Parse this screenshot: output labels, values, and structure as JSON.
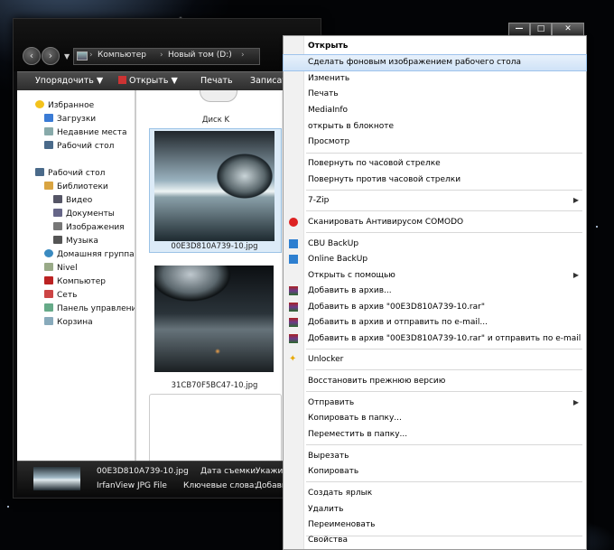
{
  "address": {
    "crumbs": [
      "Компьютер",
      "Новый том (D:)"
    ]
  },
  "toolbar": {
    "organize": "Упорядочить",
    "open": "Открыть",
    "print": "Печать",
    "record": "Записат"
  },
  "sidebar": {
    "items": [
      {
        "label": "Избранное",
        "icon": "star-icon"
      },
      {
        "label": "Загрузки",
        "icon": "downloads-folder-icon"
      },
      {
        "label": "Недавние места",
        "icon": "recent-places-icon"
      },
      {
        "label": "Рабочий стол",
        "icon": "desktop-icon"
      },
      {
        "label": "Рабочий стол",
        "icon": "desktop-icon"
      },
      {
        "label": "Библиотеки",
        "icon": "libraries-icon"
      },
      {
        "label": "Видео",
        "icon": "video-icon"
      },
      {
        "label": "Документы",
        "icon": "documents-icon"
      },
      {
        "label": "Изображения",
        "icon": "pictures-icon"
      },
      {
        "label": "Музыка",
        "icon": "music-icon"
      },
      {
        "label": "Домашняя группа",
        "icon": "homegroup-icon"
      },
      {
        "label": "Nivel",
        "icon": "user-icon"
      },
      {
        "label": "Компьютер",
        "icon": "computer-icon"
      },
      {
        "label": "Сеть",
        "icon": "network-icon"
      },
      {
        "label": "Панель управления",
        "icon": "control-panel-icon"
      },
      {
        "label": "Корзина",
        "icon": "recycle-bin-icon"
      }
    ]
  },
  "files": {
    "drive_label": "Диск K",
    "file1": "00E3D810A739-10.jpg",
    "file2": "31CB70F5BC47-10.jpg"
  },
  "details": {
    "filename": "00E3D810A739-10.jpg",
    "filetype": "IrfanView JPG File",
    "date_label": "Дата съемки:",
    "date_value": "Укажит",
    "keywords_label": "Ключевые слова:",
    "keywords_value": "Добавь"
  },
  "window_controls": {
    "minimize": "—",
    "maximize": "□",
    "close": "✕"
  },
  "context_menu": {
    "items": [
      "Открыть",
      "Сделать фоновым изображением рабочего стола",
      "Изменить",
      "Печать",
      "MediaInfo",
      "открыть в блокноте",
      "Просмотр",
      "Повернуть по часовой стрелке",
      "Повернуть против часовой стрелки",
      "7-Zip",
      "Сканировать Антивирусом COMODO",
      "CBU BackUp",
      "Online BackUp",
      "Открыть с помощью",
      "Добавить в архив...",
      "Добавить в архив \"00E3D810A739-10.rar\"",
      "Добавить в архив и отправить по e-mail...",
      "Добавить в архив \"00E3D810A739-10.rar\" и отправить по e-mail",
      "Unlocker",
      "Восстановить прежнюю версию",
      "Отправить",
      "Копировать в папку...",
      "Переместить в папку...",
      "Вырезать",
      "Копировать",
      "Создать ярлык",
      "Удалить",
      "Переименовать",
      "Свойства"
    ]
  }
}
